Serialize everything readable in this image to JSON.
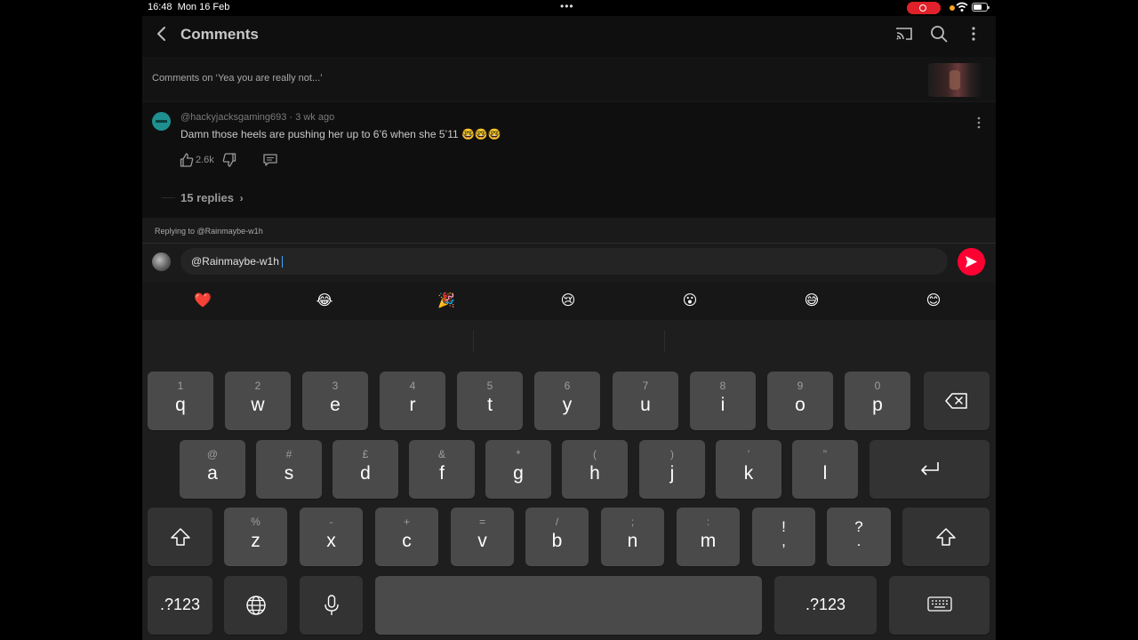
{
  "status_bar": {
    "time": "16:48",
    "date": "Mon 16 Feb",
    "dots": "•••"
  },
  "header": {
    "title": "Comments"
  },
  "comments_header": {
    "text": "Comments on ‘Yea you are really not...’"
  },
  "comment": {
    "author": "@hackyjacksgaming693",
    "age": "3 wk ago",
    "text": "Damn those heels are pushing her up to 6’6 when she 5’11 🤓🤓🤓",
    "likes": "2.6k",
    "replies": "15 replies"
  },
  "reply": {
    "replying_to": "Replying to @Rainmaybe-w1h",
    "input_value": "@Rainmaybe-w1h"
  },
  "emojis": [
    "❤️",
    "😂",
    "🎉",
    "😢",
    "😮",
    "😅",
    "😊"
  ],
  "keyboard": {
    "row1": [
      {
        "sub": "1",
        "main": "q"
      },
      {
        "sub": "2",
        "main": "w"
      },
      {
        "sub": "3",
        "main": "e"
      },
      {
        "sub": "4",
        "main": "r"
      },
      {
        "sub": "5",
        "main": "t"
      },
      {
        "sub": "6",
        "main": "y"
      },
      {
        "sub": "7",
        "main": "u"
      },
      {
        "sub": "8",
        "main": "i"
      },
      {
        "sub": "9",
        "main": "o"
      },
      {
        "sub": "0",
        "main": "p"
      }
    ],
    "row2": [
      {
        "sub": "@",
        "main": "a"
      },
      {
        "sub": "#",
        "main": "s"
      },
      {
        "sub": "£",
        "main": "d"
      },
      {
        "sub": "&",
        "main": "f"
      },
      {
        "sub": "*",
        "main": "g"
      },
      {
        "sub": "(",
        "main": "h"
      },
      {
        "sub": ")",
        "main": "j"
      },
      {
        "sub": "’",
        "main": "k"
      },
      {
        "sub": "\"",
        "main": "l"
      }
    ],
    "row3": [
      {
        "sub": "%",
        "main": "z"
      },
      {
        "sub": "-",
        "main": "x"
      },
      {
        "sub": "+",
        "main": "c"
      },
      {
        "sub": "=",
        "main": "v"
      },
      {
        "sub": "/",
        "main": "b"
      },
      {
        "sub": ";",
        "main": "n"
      },
      {
        "sub": ":",
        "main": "m"
      }
    ],
    "punct1": {
      "top": "!",
      "bottom": ","
    },
    "punct2": {
      "top": "?",
      "bottom": "."
    },
    "numbers_label": ".?123"
  }
}
